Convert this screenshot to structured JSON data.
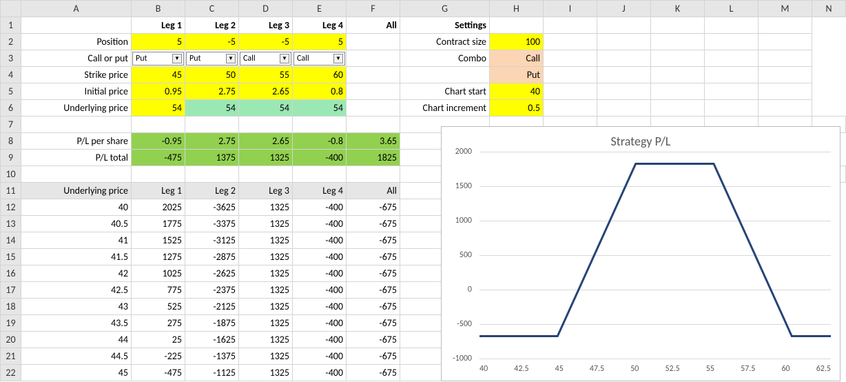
{
  "columns": [
    "A",
    "B",
    "C",
    "D",
    "E",
    "F",
    "G",
    "H",
    "I",
    "J",
    "K",
    "L",
    "M",
    "N"
  ],
  "row_labels": [
    "1",
    "2",
    "3",
    "4",
    "5",
    "6",
    "7",
    "8",
    "9",
    "10",
    "11",
    "12",
    "13",
    "14",
    "15",
    "16",
    "17",
    "18",
    "19",
    "20",
    "21",
    "22"
  ],
  "header_row": {
    "legs": [
      "Leg 1",
      "Leg 2",
      "Leg 3",
      "Leg 4",
      "All"
    ],
    "settings": "Settings"
  },
  "rows": {
    "position": {
      "label": "Position",
      "vals": [
        "5",
        "-5",
        "-5",
        "5"
      ],
      "setting_label": "Contract size",
      "setting_val": "100"
    },
    "call_or_put": {
      "label": "Call or put",
      "vals": [
        "Put",
        "Put",
        "Call",
        "Call"
      ],
      "setting_label": "Combo",
      "setting_val": "Call"
    },
    "strike": {
      "label": "Strike price",
      "vals": [
        "45",
        "50",
        "55",
        "60"
      ],
      "setting_label": "",
      "setting_val": "Put"
    },
    "initial_price": {
      "label": "Initial price",
      "vals": [
        "0.95",
        "2.75",
        "2.65",
        "0.8"
      ],
      "setting_label": "Chart start",
      "setting_val": "40"
    },
    "underlying": {
      "label": "Underlying price",
      "vals": [
        "54",
        "54",
        "54",
        "54"
      ],
      "setting_label": "Chart increment",
      "setting_val": "0.5"
    },
    "pl_share": {
      "label": "P/L per share",
      "vals": [
        "-0.95",
        "2.75",
        "2.65",
        "-0.8",
        "3.65"
      ]
    },
    "pl_total": {
      "label": "P/L total",
      "vals": [
        "-475",
        "1375",
        "1325",
        "-400",
        "1825"
      ]
    }
  },
  "table_header": {
    "b": "Underlying price",
    "legs": [
      "Leg 1",
      "Leg 2",
      "Leg 3",
      "Leg 4",
      "All"
    ]
  },
  "table_rows": [
    {
      "u": "40",
      "c": [
        "2025",
        "-3625",
        "1325",
        "-400",
        "-675"
      ]
    },
    {
      "u": "40.5",
      "c": [
        "1775",
        "-3375",
        "1325",
        "-400",
        "-675"
      ]
    },
    {
      "u": "41",
      "c": [
        "1525",
        "-3125",
        "1325",
        "-400",
        "-675"
      ]
    },
    {
      "u": "41.5",
      "c": [
        "1275",
        "-2875",
        "1325",
        "-400",
        "-675"
      ]
    },
    {
      "u": "42",
      "c": [
        "1025",
        "-2625",
        "1325",
        "-400",
        "-675"
      ]
    },
    {
      "u": "42.5",
      "c": [
        "775",
        "-2375",
        "1325",
        "-400",
        "-675"
      ]
    },
    {
      "u": "43",
      "c": [
        "525",
        "-2125",
        "1325",
        "-400",
        "-675"
      ]
    },
    {
      "u": "43.5",
      "c": [
        "275",
        "-1875",
        "1325",
        "-400",
        "-675"
      ]
    },
    {
      "u": "44",
      "c": [
        "25",
        "-1625",
        "1325",
        "-400",
        "-675"
      ]
    },
    {
      "u": "44.5",
      "c": [
        "-225",
        "-1375",
        "1325",
        "-400",
        "-675"
      ]
    },
    {
      "u": "45",
      "c": [
        "-475",
        "-1125",
        "1325",
        "-400",
        "-675"
      ]
    }
  ],
  "chart_data": {
    "type": "line",
    "title": "Strategy P/L",
    "x": [
      40,
      42.5,
      45,
      47.5,
      50,
      52.5,
      55,
      57.5,
      60,
      62.5
    ],
    "y": [
      -675,
      -675,
      -675,
      575,
      1825,
      1825,
      1825,
      575,
      -675,
      -675
    ],
    "ylim": [
      -1000,
      2000
    ],
    "yticks": [
      -1000,
      -500,
      0,
      500,
      1000,
      1500,
      2000
    ],
    "xlabels": [
      "40",
      "42.5",
      "45",
      "47.5",
      "50",
      "52.5",
      "55",
      "57.5",
      "60",
      "62.5"
    ]
  }
}
